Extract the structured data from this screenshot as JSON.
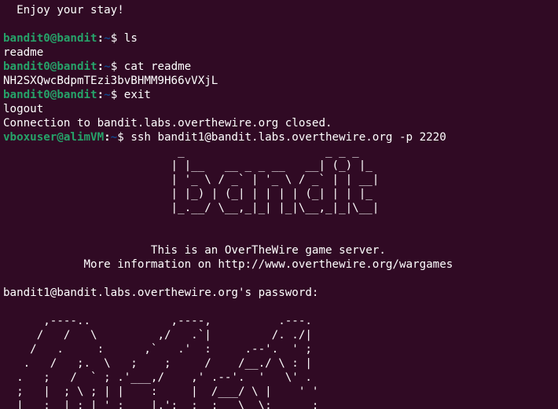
{
  "colors": {
    "background": "#300a24",
    "foreground": "#ffffff",
    "prompt_user": "#26a269",
    "prompt_path": "#12488b"
  },
  "lines": [
    {
      "text": "  Enjoy your stay!"
    },
    {
      "text": ""
    },
    {
      "prompt": {
        "user": "bandit0@bandit",
        "sep": ":",
        "path": "~",
        "sym": "$ "
      },
      "text": "ls"
    },
    {
      "text": "readme"
    },
    {
      "prompt": {
        "user": "bandit0@bandit",
        "sep": ":",
        "path": "~",
        "sym": "$ "
      },
      "text": "cat readme"
    },
    {
      "text": "NH2SXQwcBdpmTEzi3bvBHMM9H66vVXjL"
    },
    {
      "prompt": {
        "user": "bandit0@bandit",
        "sep": ":",
        "path": "~",
        "sym": "$ "
      },
      "text": "exit"
    },
    {
      "text": "logout"
    },
    {
      "text": "Connection to bandit.labs.overthewire.org closed."
    },
    {
      "prompt": {
        "user": "vboxuser@alimVM",
        "sep": ":",
        "path": "~",
        "sym": "$ "
      },
      "text": "ssh bandit1@bandit.labs.overthewire.org -p 2220"
    },
    {
      "text": "                          _                     _ _ _   "
    },
    {
      "text": "                         | |__   __ _ _ __   __| (_) |_ "
    },
    {
      "text": "                         | '_ \\ / _` | '_ \\ / _` | | __|"
    },
    {
      "text": "                         | |_) | (_| | | | | (_| | | |_ "
    },
    {
      "text": "                         |_.__/ \\__,_|_| |_|\\__,_|_|\\__|"
    },
    {
      "text": ""
    },
    {
      "text": ""
    },
    {
      "text": "                      This is an OverTheWire game server."
    },
    {
      "text": "            More information on http://www.overthewire.org/wargames"
    },
    {
      "text": ""
    },
    {
      "text": "bandit1@bandit.labs.overthewire.org's password: "
    },
    {
      "text": ""
    },
    {
      "text": "      ,----..            ,----,          .---."
    },
    {
      "text": "     /   /   \\         ,/   .`|         /. ./|"
    },
    {
      "text": "    /   .     :      ,`   .'  :     .--'.  ' ;"
    },
    {
      "text": "   .   /   ;.  \\   ;    ;     /    /__./ \\ : |"
    },
    {
      "text": "  .   ;   /  ` ; .'___,/    ,' .--'.  '   \\' ."
    },
    {
      "text": "  ;   |  ; \\ ; | |    :     |  /___/ \\ |    ' '"
    },
    {
      "text": "  |   :  | ; | ' ;    |.';  ;  ;   \\  \\;      :"
    }
  ]
}
